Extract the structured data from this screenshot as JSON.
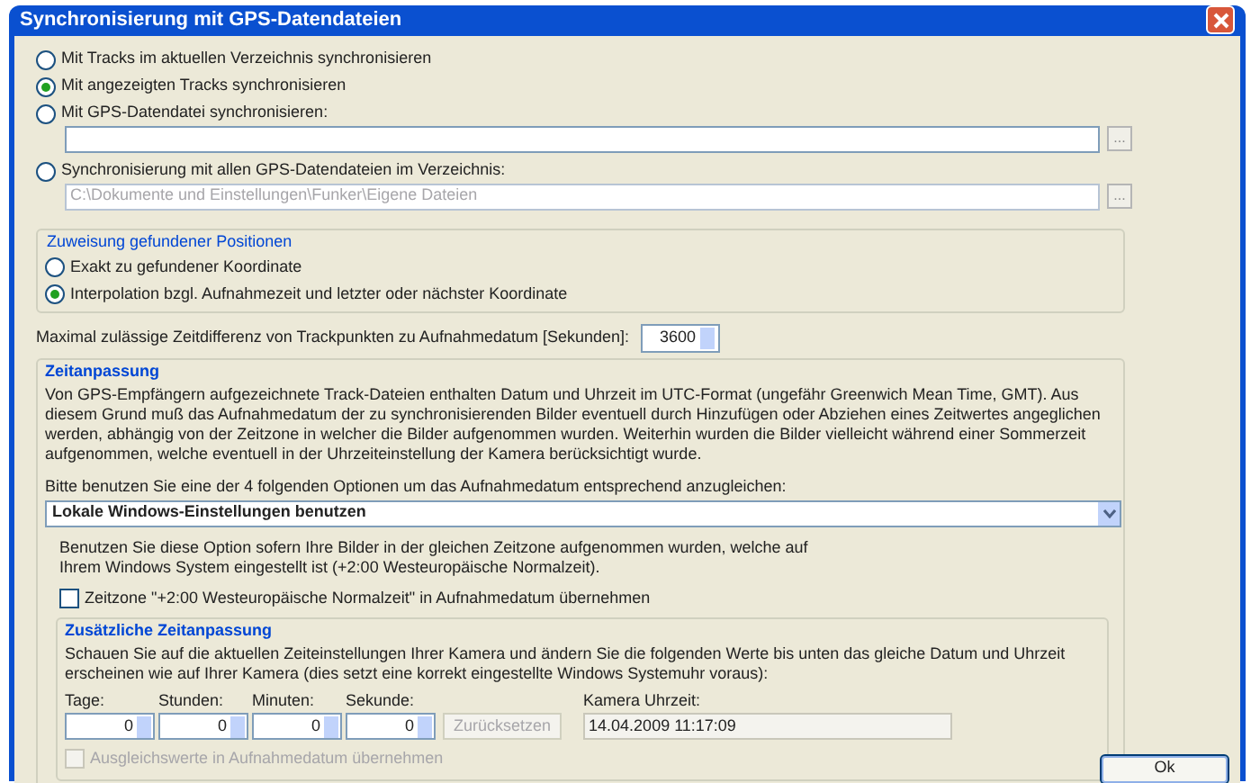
{
  "window": {
    "title": "Synchronisierung mit GPS-Datendateien"
  },
  "sync_options": [
    {
      "label": "Mit Tracks im aktuellen Verzeichnis synchronisieren",
      "selected": false
    },
    {
      "label": "Mit angezeigten Tracks synchronisieren",
      "selected": true
    },
    {
      "label": "Mit GPS-Datendatei synchronisieren:",
      "selected": false,
      "field": {
        "disabled": false,
        "browse": "..."
      }
    },
    {
      "label": "Synchronisierung mit allen GPS-Datendateien im Verzeichnis:",
      "selected": false,
      "field": {
        "value": "C:\\Dokumente und Einstellungen\\Funker\\Eigene Dateien",
        "disabled": true,
        "browse": "..."
      }
    }
  ],
  "assignment": {
    "title": "Zuweisung gefundener Positionen",
    "options": [
      {
        "label": "Exakt zu gefundener Koordinate",
        "selected": false
      },
      {
        "label": "Interpolation bzgl. Aufnahmezeit und letzter oder nächster Koordinate",
        "selected": true
      }
    ]
  },
  "max_diff": {
    "label": "Maximal zulässige Zeitdifferenz von Trackpunkten zu Aufnahmedatum [Sekunden]:",
    "value": "3600"
  },
  "time_adjustment": {
    "title": "Zeitanpassung",
    "description": "Von GPS-Empfängern aufgezeichnete Track-Dateien enthalten Datum und Uhrzeit im UTC-Format (ungefähr Greenwich Mean Time, GMT). Aus diesem Grund muß das Aufnahmedatum der zu synchronisierenden Bilder eventuell durch Hinzufügen oder Abziehen eines Zeitwertes angeglichen werden, abhängig von der Zeitzone in welcher die Bilder aufgenommen wurden. Weiterhin wurden die Bilder vielleicht während einer Sommerzeit aufgenommen, welche eventuell in der Uhrzeiteinstellung der Kamera berücksichtigt wurde.",
    "prompt": "Bitte benutzen Sie eine der 4 folgenden Optionen um das Aufnahmedatum entsprechend anzugleichen:",
    "dropdown": {
      "value": "Lokale Windows-Einstellungen benutzen"
    },
    "option_description": "Benutzen Sie diese Option sofern Ihre Bilder in der gleichen Zeitzone aufgenommen wurden, welche auf Ihrem Windows System eingestellt ist (+2:00 Westeuropäische Normalzeit).",
    "timezone_checkbox": {
      "label": "Zeitzone \"+2:00 Westeuropäische Normalzeit\" in Aufnahmedatum übernehmen",
      "checked": false,
      "disabled": false
    },
    "additional": {
      "title": "Zusätzliche Zeitanpassung",
      "description": "Schauen Sie auf die aktuellen Zeiteinstellungen Ihrer Kamera und ändern Sie die folgenden Werte bis unten das gleiche Datum und Uhrzeit erscheinen wie auf Ihrer Kamera (dies setzt eine korrekt eingestellte Windows Systemuhr voraus):",
      "spinners": [
        {
          "label": "Tage:",
          "value": "0"
        },
        {
          "label": "Stunden:",
          "value": "0"
        },
        {
          "label": "Minuten:",
          "value": "0"
        },
        {
          "label": "Sekunde:",
          "value": "0"
        }
      ],
      "reset_button": {
        "label": "Zurücksetzen",
        "disabled": true
      },
      "camera_time": {
        "label": "Kamera Uhrzeit:",
        "value": "14.04.2009 11:17:09"
      },
      "apply_checkbox": {
        "label": "Ausgleichswerte in Aufnahmedatum übernehmen",
        "checked": false,
        "disabled": true
      }
    }
  },
  "buttons": [
    {
      "label": "Ok"
    }
  ]
}
